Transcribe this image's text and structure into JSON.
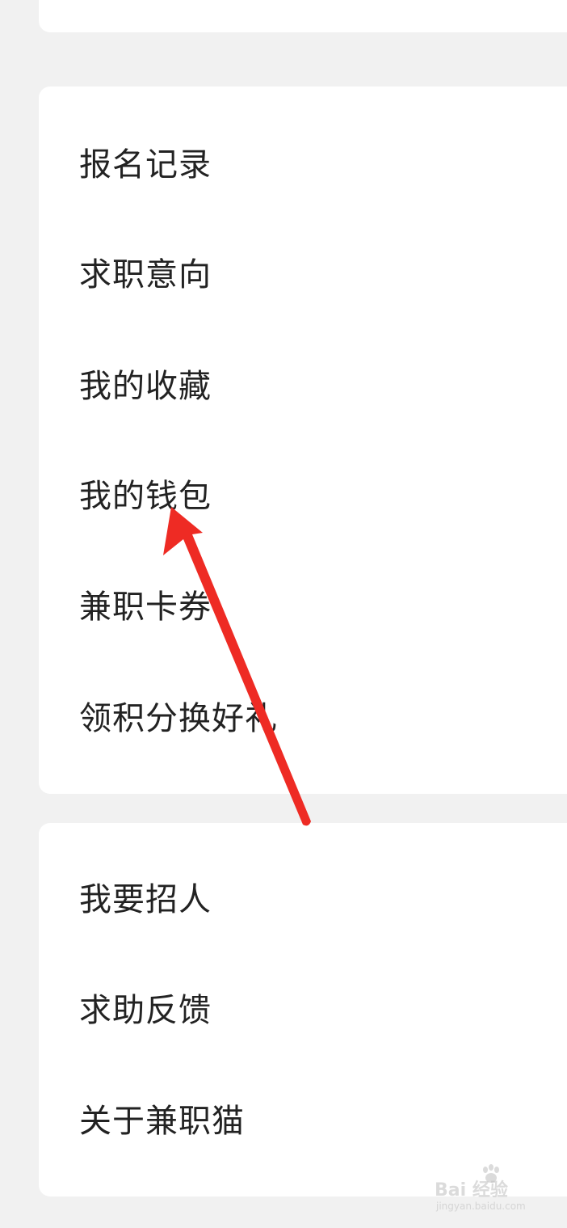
{
  "menu_main": [
    {
      "label": "报名记录"
    },
    {
      "label": "求职意向"
    },
    {
      "label": "我的收藏"
    },
    {
      "label": "我的钱包"
    },
    {
      "label": "兼职卡券"
    },
    {
      "label": "领积分换好礼"
    }
  ],
  "menu_secondary": [
    {
      "label": "我要招人"
    },
    {
      "label": "求助反馈"
    },
    {
      "label": "关于兼职猫"
    }
  ],
  "annotation": {
    "arrow_color": "#ee2b24",
    "points_to": "我的钱包"
  },
  "watermark": {
    "brand": "Bai 经验",
    "url": "jingyan.baidu.com"
  },
  "colors": {
    "background": "#f1f1f1",
    "card": "#ffffff",
    "text": "#222222"
  }
}
